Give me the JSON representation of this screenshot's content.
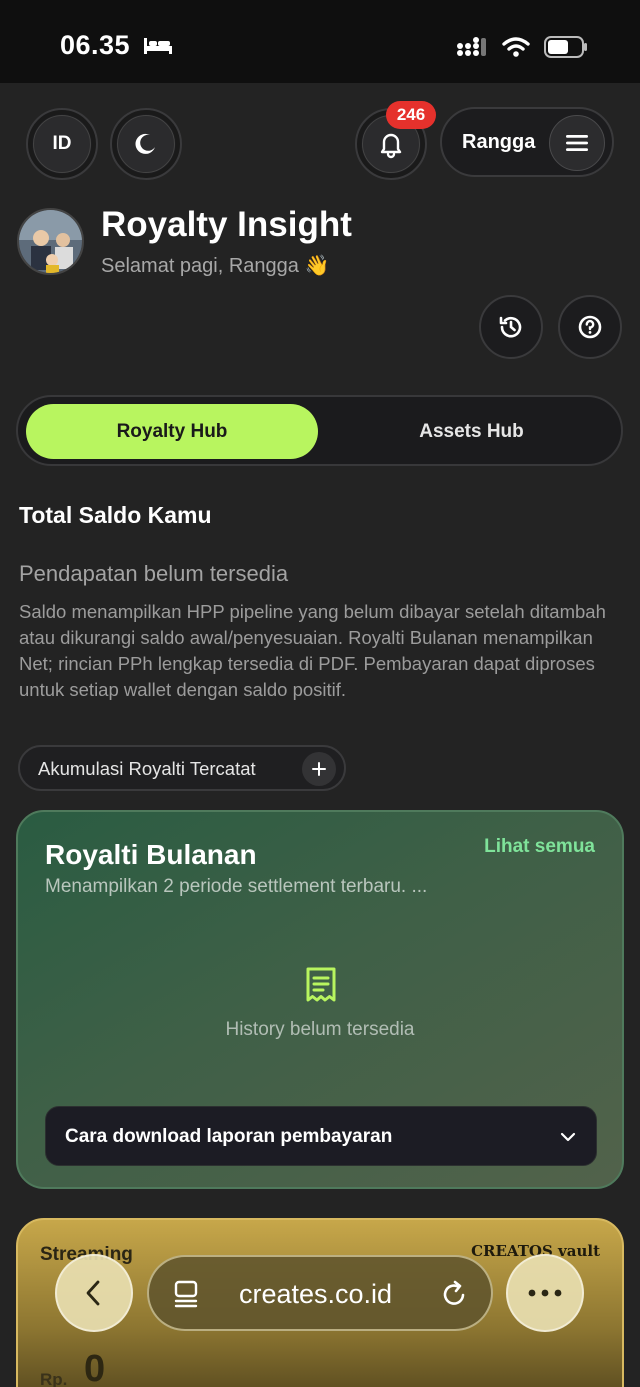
{
  "status_bar": {
    "time": "06.35",
    "icons": [
      "bed-icon",
      "signal-icon",
      "wifi-icon",
      "battery-icon"
    ]
  },
  "header": {
    "language": "ID",
    "theme_icon": "moon-icon",
    "notification_count": "246",
    "user_name": "Rangga"
  },
  "profile": {
    "title": "Royalty Insight",
    "greeting": "Selamat pagi, Rangga 👋"
  },
  "tabs": [
    {
      "label": "Royalty Hub",
      "active": true
    },
    {
      "label": "Assets Hub",
      "active": false
    }
  ],
  "balance": {
    "section_title": "Total Saldo Kamu",
    "status": "Pendapatan belum tersedia",
    "description": "Saldo menampilkan HPP pipeline yang belum dibayar setelah ditambah atau dikurangi saldo awal/penyesuaian. Royalti Bulanan menampilkan Net; rincian PPh lengkap tersedia di PDF. Pembayaran dapat diproses untuk setiap wallet dengan saldo positif.",
    "accumulation_label": "Akumulasi Royalti Tercatat"
  },
  "royalty_card": {
    "title": "Royalti Bulanan",
    "link": "Lihat semua",
    "subtitle": "Menampilkan 2 periode settlement terbaru. ...",
    "empty_text": "History belum tersedia",
    "download_label": "Cara download laporan pembayaran"
  },
  "stream_card": {
    "label": "Streaming",
    "brand": "CREATOS vault",
    "currency": "Rp.",
    "amount": "0"
  },
  "browser": {
    "url": "creates.co.id"
  },
  "colors": {
    "accent_green": "#b8f55f",
    "link_green": "#7fe39a",
    "badge_red": "#e5312c",
    "background": "#232323"
  }
}
